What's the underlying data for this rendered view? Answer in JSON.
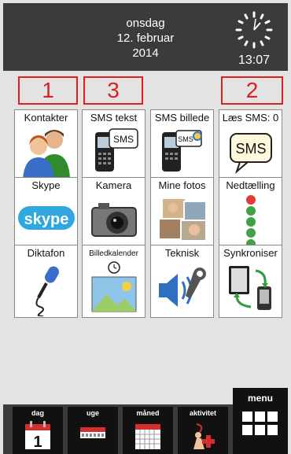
{
  "header": {
    "weekday": "onsdag",
    "date": "12. februar",
    "year": "2014",
    "time": "13:07"
  },
  "markers": [
    "1",
    "3",
    "2"
  ],
  "tiles": [
    {
      "label": "Kontakter",
      "icon": "contacts-icon"
    },
    {
      "label": "SMS tekst",
      "icon": "sms-phone-icon"
    },
    {
      "label": "SMS billede",
      "icon": "mms-phone-icon"
    },
    {
      "label": "Læs SMS: 0",
      "icon": "sms-bubble-icon"
    },
    {
      "label": "Skype",
      "icon": "skype-icon"
    },
    {
      "label": "Kamera",
      "icon": "camera-icon"
    },
    {
      "label": "Mine fotos",
      "icon": "photos-icon"
    },
    {
      "label": "Nedtælling",
      "icon": "countdown-lights-icon"
    },
    {
      "label": "Diktafon",
      "icon": "microphone-icon"
    },
    {
      "label": "Billedkalender",
      "icon": "picture-calendar-icon"
    },
    {
      "label": "Teknisk",
      "icon": "technical-icon"
    },
    {
      "label": "Synkroniser",
      "icon": "sync-icon"
    }
  ],
  "sms_bubble_text": "SMS",
  "skype_text": "skype",
  "calendar_day_number": "1",
  "nav": [
    {
      "label": "dag",
      "icon": "day-calendar-icon"
    },
    {
      "label": "uge",
      "icon": "week-calendar-icon"
    },
    {
      "label": "måned",
      "icon": "month-calendar-icon"
    },
    {
      "label": "aktivitet",
      "icon": "activity-icon"
    }
  ],
  "menu": {
    "label": "menu",
    "icon": "grid-menu-icon"
  },
  "colors": {
    "header_bg": "#3b3b3b",
    "page_bg": "#e3e3e3",
    "marker_red": "#e02020",
    "calendar_red": "#d32f2f"
  }
}
